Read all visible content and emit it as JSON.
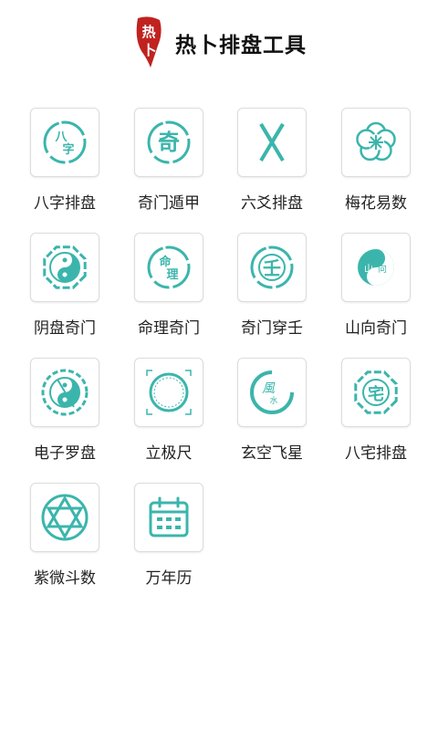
{
  "header": {
    "logo_text": "热卜",
    "title": "热卜排盘工具"
  },
  "colors": {
    "accent": "#3bb5ac",
    "logo_red": "#c0221f"
  },
  "tools": [
    {
      "label": "八字排盘",
      "icon": "bazi-icon",
      "glyph": "八字"
    },
    {
      "label": "奇门遁甲",
      "icon": "qimen-icon",
      "glyph": "奇"
    },
    {
      "label": "六爻排盘",
      "icon": "liuyao-icon",
      "glyph": ""
    },
    {
      "label": "梅花易数",
      "icon": "plum-blossom-icon",
      "glyph": ""
    },
    {
      "label": "阴盘奇门",
      "icon": "yinpan-icon",
      "glyph": ""
    },
    {
      "label": "命理奇门",
      "icon": "mingli-icon",
      "glyph": "命理"
    },
    {
      "label": "奇门穿壬",
      "icon": "chuanren-icon",
      "glyph": "壬"
    },
    {
      "label": "山向奇门",
      "icon": "shanxiang-icon",
      "glyph": "山向"
    },
    {
      "label": "电子罗盘",
      "icon": "compass-icon",
      "glyph": ""
    },
    {
      "label": "立极尺",
      "icon": "liji-ruler-icon",
      "glyph": ""
    },
    {
      "label": "玄空飞星",
      "icon": "fengshui-icon",
      "glyph": "風水"
    },
    {
      "label": "八宅排盘",
      "icon": "bazhai-icon",
      "glyph": "宅"
    },
    {
      "label": "紫微斗数",
      "icon": "ziwei-icon",
      "glyph": ""
    },
    {
      "label": "万年历",
      "icon": "calendar-icon",
      "glyph": ""
    }
  ]
}
